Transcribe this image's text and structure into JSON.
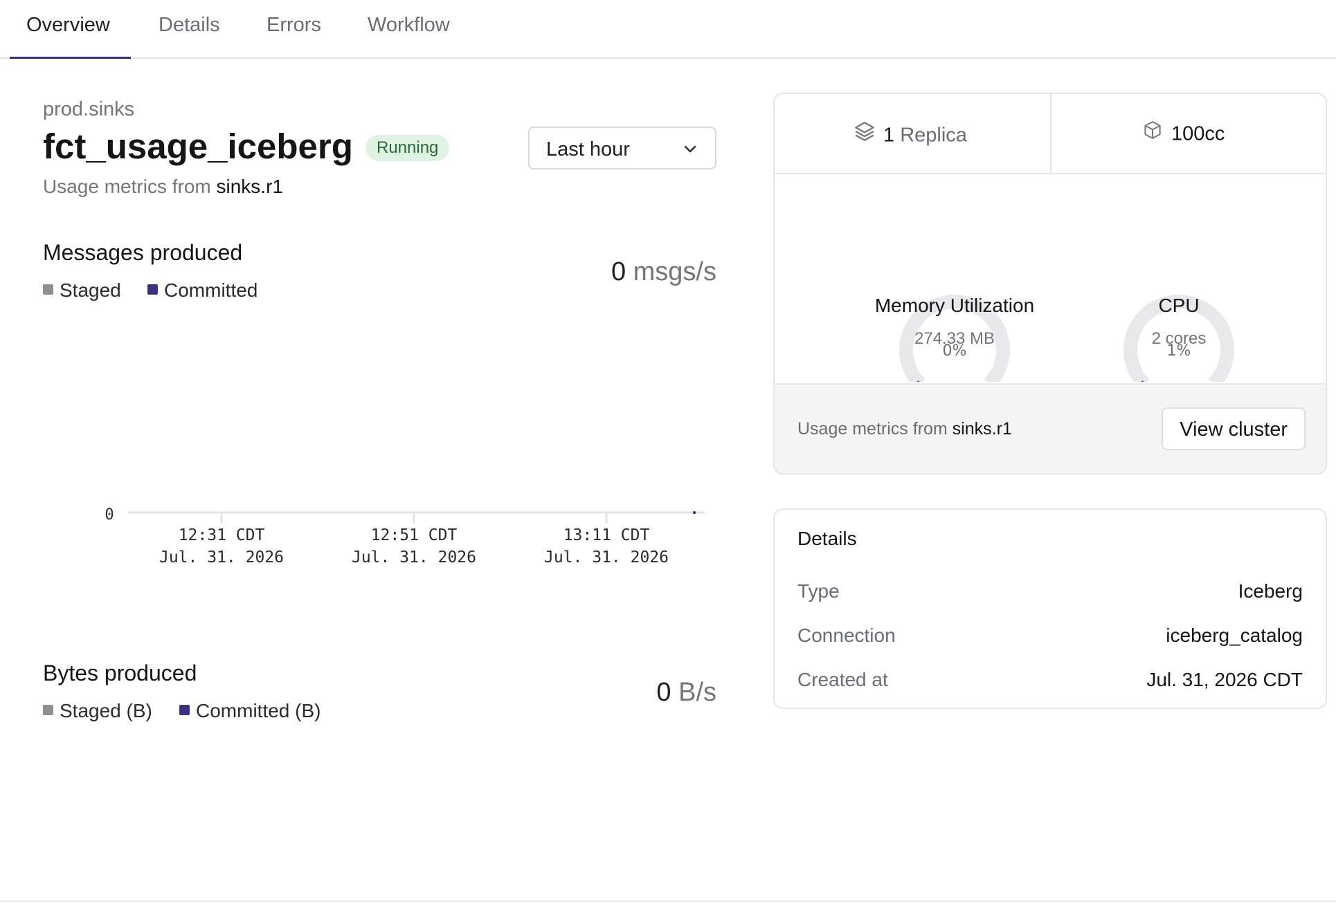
{
  "tabs": [
    {
      "label": "Overview",
      "active": true
    },
    {
      "label": "Details",
      "active": false
    },
    {
      "label": "Errors",
      "active": false
    },
    {
      "label": "Workflow",
      "active": false
    }
  ],
  "header": {
    "schema": "prod.sinks",
    "title": "fct_usage_iceberg",
    "status": "Running",
    "subtitle_prefix": "Usage metrics from ",
    "subtitle_cluster": "sinks.r1"
  },
  "time_range": {
    "selected": "Last hour"
  },
  "messages": {
    "title": "Messages produced",
    "legend": [
      {
        "label": "Staged",
        "color": "#8e8e93"
      },
      {
        "label": "Committed",
        "color": "#3c2f86"
      }
    ],
    "rate_value": "0",
    "rate_unit": "msgs/s"
  },
  "bytes": {
    "title": "Bytes produced",
    "legend": [
      {
        "label": "Staged (B)",
        "color": "#8e8e93"
      },
      {
        "label": "Committed (B)",
        "color": "#3c2f86"
      }
    ],
    "rate_value": "0",
    "rate_unit": "B/s"
  },
  "chart_data": {
    "type": "line",
    "title": "Messages produced",
    "y_tick_labels": [
      "0"
    ],
    "x_ticks": [
      {
        "time": "12:31 CDT",
        "date": "Jul. 31. 2026"
      },
      {
        "time": "12:51 CDT",
        "date": "Jul. 31. 2026"
      },
      {
        "time": "13:11 CDT",
        "date": "Jul. 31. 2026"
      }
    ],
    "series": [
      {
        "name": "Staged",
        "color": "#8e8e93",
        "values": [
          0
        ]
      },
      {
        "name": "Committed",
        "color": "#3c2f86",
        "values": [
          0
        ]
      }
    ],
    "ylim": [
      0,
      0
    ],
    "grid": false,
    "legend_position": "top-left"
  },
  "resources": {
    "replica_count": "1",
    "replica_label": "Replica",
    "size": "100cc",
    "replica_icon": "layers-icon",
    "size_icon": "cube-icon",
    "memory": {
      "percent": "0%",
      "fraction": 0.0,
      "label": "Memory Utilization",
      "sub": "274.33 MB"
    },
    "cpu": {
      "percent": "1%",
      "fraction": 0.01,
      "label": "CPU",
      "sub": "2 cores"
    },
    "footer_prefix": "Usage metrics from ",
    "footer_cluster": "sinks.r1",
    "view_cluster_label": "View cluster",
    "gauge_track_color": "#e9e9ec",
    "gauge_fill_color": "#3c2f86"
  },
  "details": {
    "title": "Details",
    "rows": [
      {
        "key": "Type",
        "value": "Iceberg"
      },
      {
        "key": "Connection",
        "value": "iceberg_catalog"
      },
      {
        "key": "Created at",
        "value": "Jul. 31, 2026 CDT"
      }
    ]
  }
}
